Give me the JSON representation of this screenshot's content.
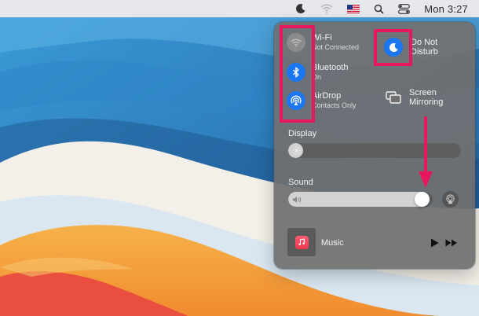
{
  "menubar": {
    "icons": [
      "moon-icon",
      "wifi-icon",
      "us-flag-icon",
      "search-icon",
      "control-center-icon"
    ],
    "clock": "Mon 3:27"
  },
  "control_center": {
    "wifi": {
      "title": "Wi-Fi",
      "status": "Not Connected",
      "icon": "wifi-icon"
    },
    "bluetooth": {
      "title": "Bluetooth",
      "status": "On",
      "icon": "bluetooth-icon"
    },
    "airdrop": {
      "title": "AirDrop",
      "status": "Contacts Only",
      "icon": "airdrop-icon"
    },
    "do_not_disturb": {
      "title_line1": "Do Not",
      "title_line2": "Disturb",
      "icon": "moon-icon"
    },
    "screen_mirroring": {
      "title_line1": "Screen",
      "title_line2": "Mirroring",
      "icon": "screen-mirroring-icon"
    },
    "display": {
      "label": "Display",
      "level": 0.02
    },
    "sound": {
      "label": "Sound",
      "level": 0.98
    },
    "now_playing": {
      "app": "Music"
    }
  },
  "annotations": {
    "color": "#e8175d",
    "highlights": [
      "network-tiles",
      "do-not-disturb-tile"
    ],
    "arrow_target": "sound-slider-knob"
  },
  "colors": {
    "accent_blue": "#1b76f2",
    "panel_bg": "#707070"
  }
}
